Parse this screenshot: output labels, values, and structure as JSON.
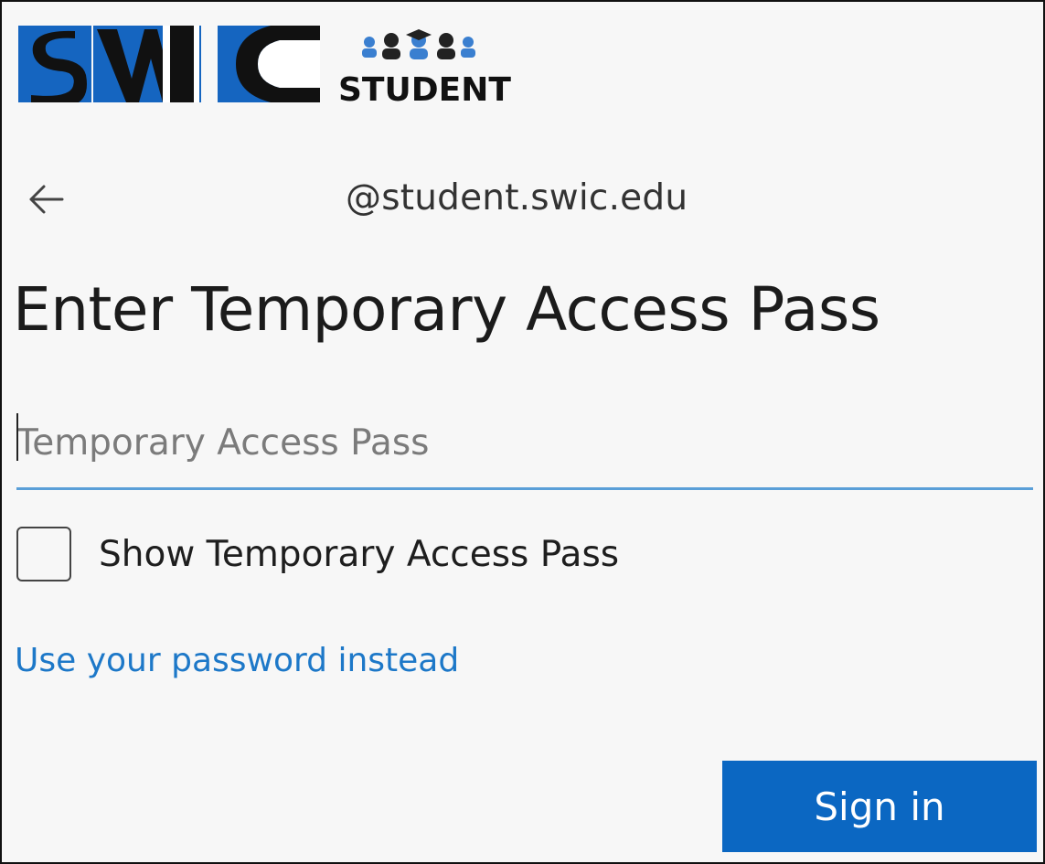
{
  "logo": {
    "wordmark": "SWIC",
    "subtitle": "STUDENT",
    "colors": {
      "blue": "#1565c0",
      "black": "#111111",
      "icon_blue": "#3a7fd0"
    }
  },
  "header": {
    "back_icon": "arrow-left-icon",
    "identity": "@student.swic.edu"
  },
  "main": {
    "title": "Enter Temporary Access Pass",
    "input": {
      "placeholder": "Temporary Access Pass",
      "value": ""
    },
    "show_checkbox": {
      "label": "Show Temporary Access Pass",
      "checked": false
    },
    "alt_link": "Use your password instead",
    "signin_label": "Sign in"
  },
  "colors": {
    "accent": "#0b67c2",
    "link": "#1d78c8",
    "input_underline": "#5a9fd8",
    "background": "#f7f7f7"
  }
}
